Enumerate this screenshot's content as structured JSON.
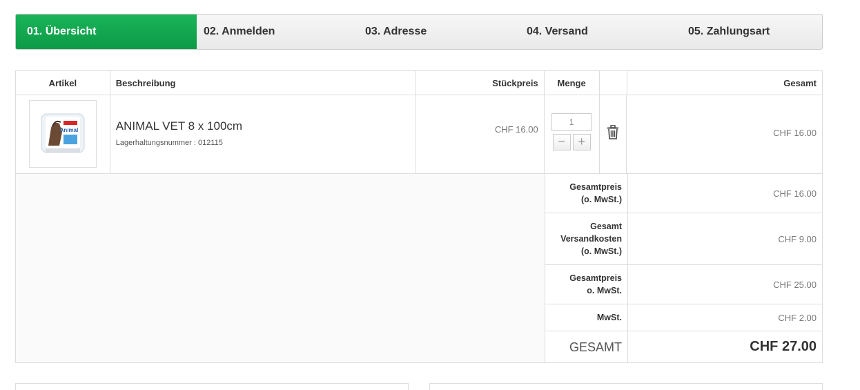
{
  "steps": [
    {
      "label": "01. Übersicht",
      "active": true
    },
    {
      "label": "02. Anmelden",
      "active": false
    },
    {
      "label": "03. Adresse",
      "active": false
    },
    {
      "label": "04. Versand",
      "active": false
    },
    {
      "label": "05. Zahlungsart",
      "active": false
    }
  ],
  "colors": {
    "accent": "#14a851",
    "border": "#dddddd"
  },
  "table": {
    "headers": {
      "article": "Artikel",
      "description": "Beschreibung",
      "unit_price": "Stückpreis",
      "quantity": "Menge",
      "total": "Gesamt"
    },
    "item": {
      "name": "ANIMAL VET 8 x 100cm",
      "sku": "Lagerhaltungsnummer : 012115",
      "unit_price": "CHF 16.00",
      "quantity": "1",
      "line_total": "CHF 16.00",
      "minus_icon": "minus-icon",
      "plus_icon": "plus-icon",
      "delete_icon": "trash-icon",
      "image_text": "Animal"
    }
  },
  "summary": {
    "subtotal_label_1": "Gesamtpreis",
    "subtotal_label_2": "(o. MwSt.)",
    "subtotal_value": "CHF 16.00",
    "shipping_label_1": "Gesamt",
    "shipping_label_2": "Versandkosten",
    "shipping_label_3": "(o. MwSt.)",
    "shipping_value": "CHF 9.00",
    "net_label_1": "Gesamtpreis",
    "net_label_2": "o. MwSt.",
    "net_value": "CHF 25.00",
    "vat_label": "MwSt.",
    "vat_value": "CHF 2.00",
    "grand_label": "GESAMT",
    "grand_value": "CHF 27.00"
  }
}
